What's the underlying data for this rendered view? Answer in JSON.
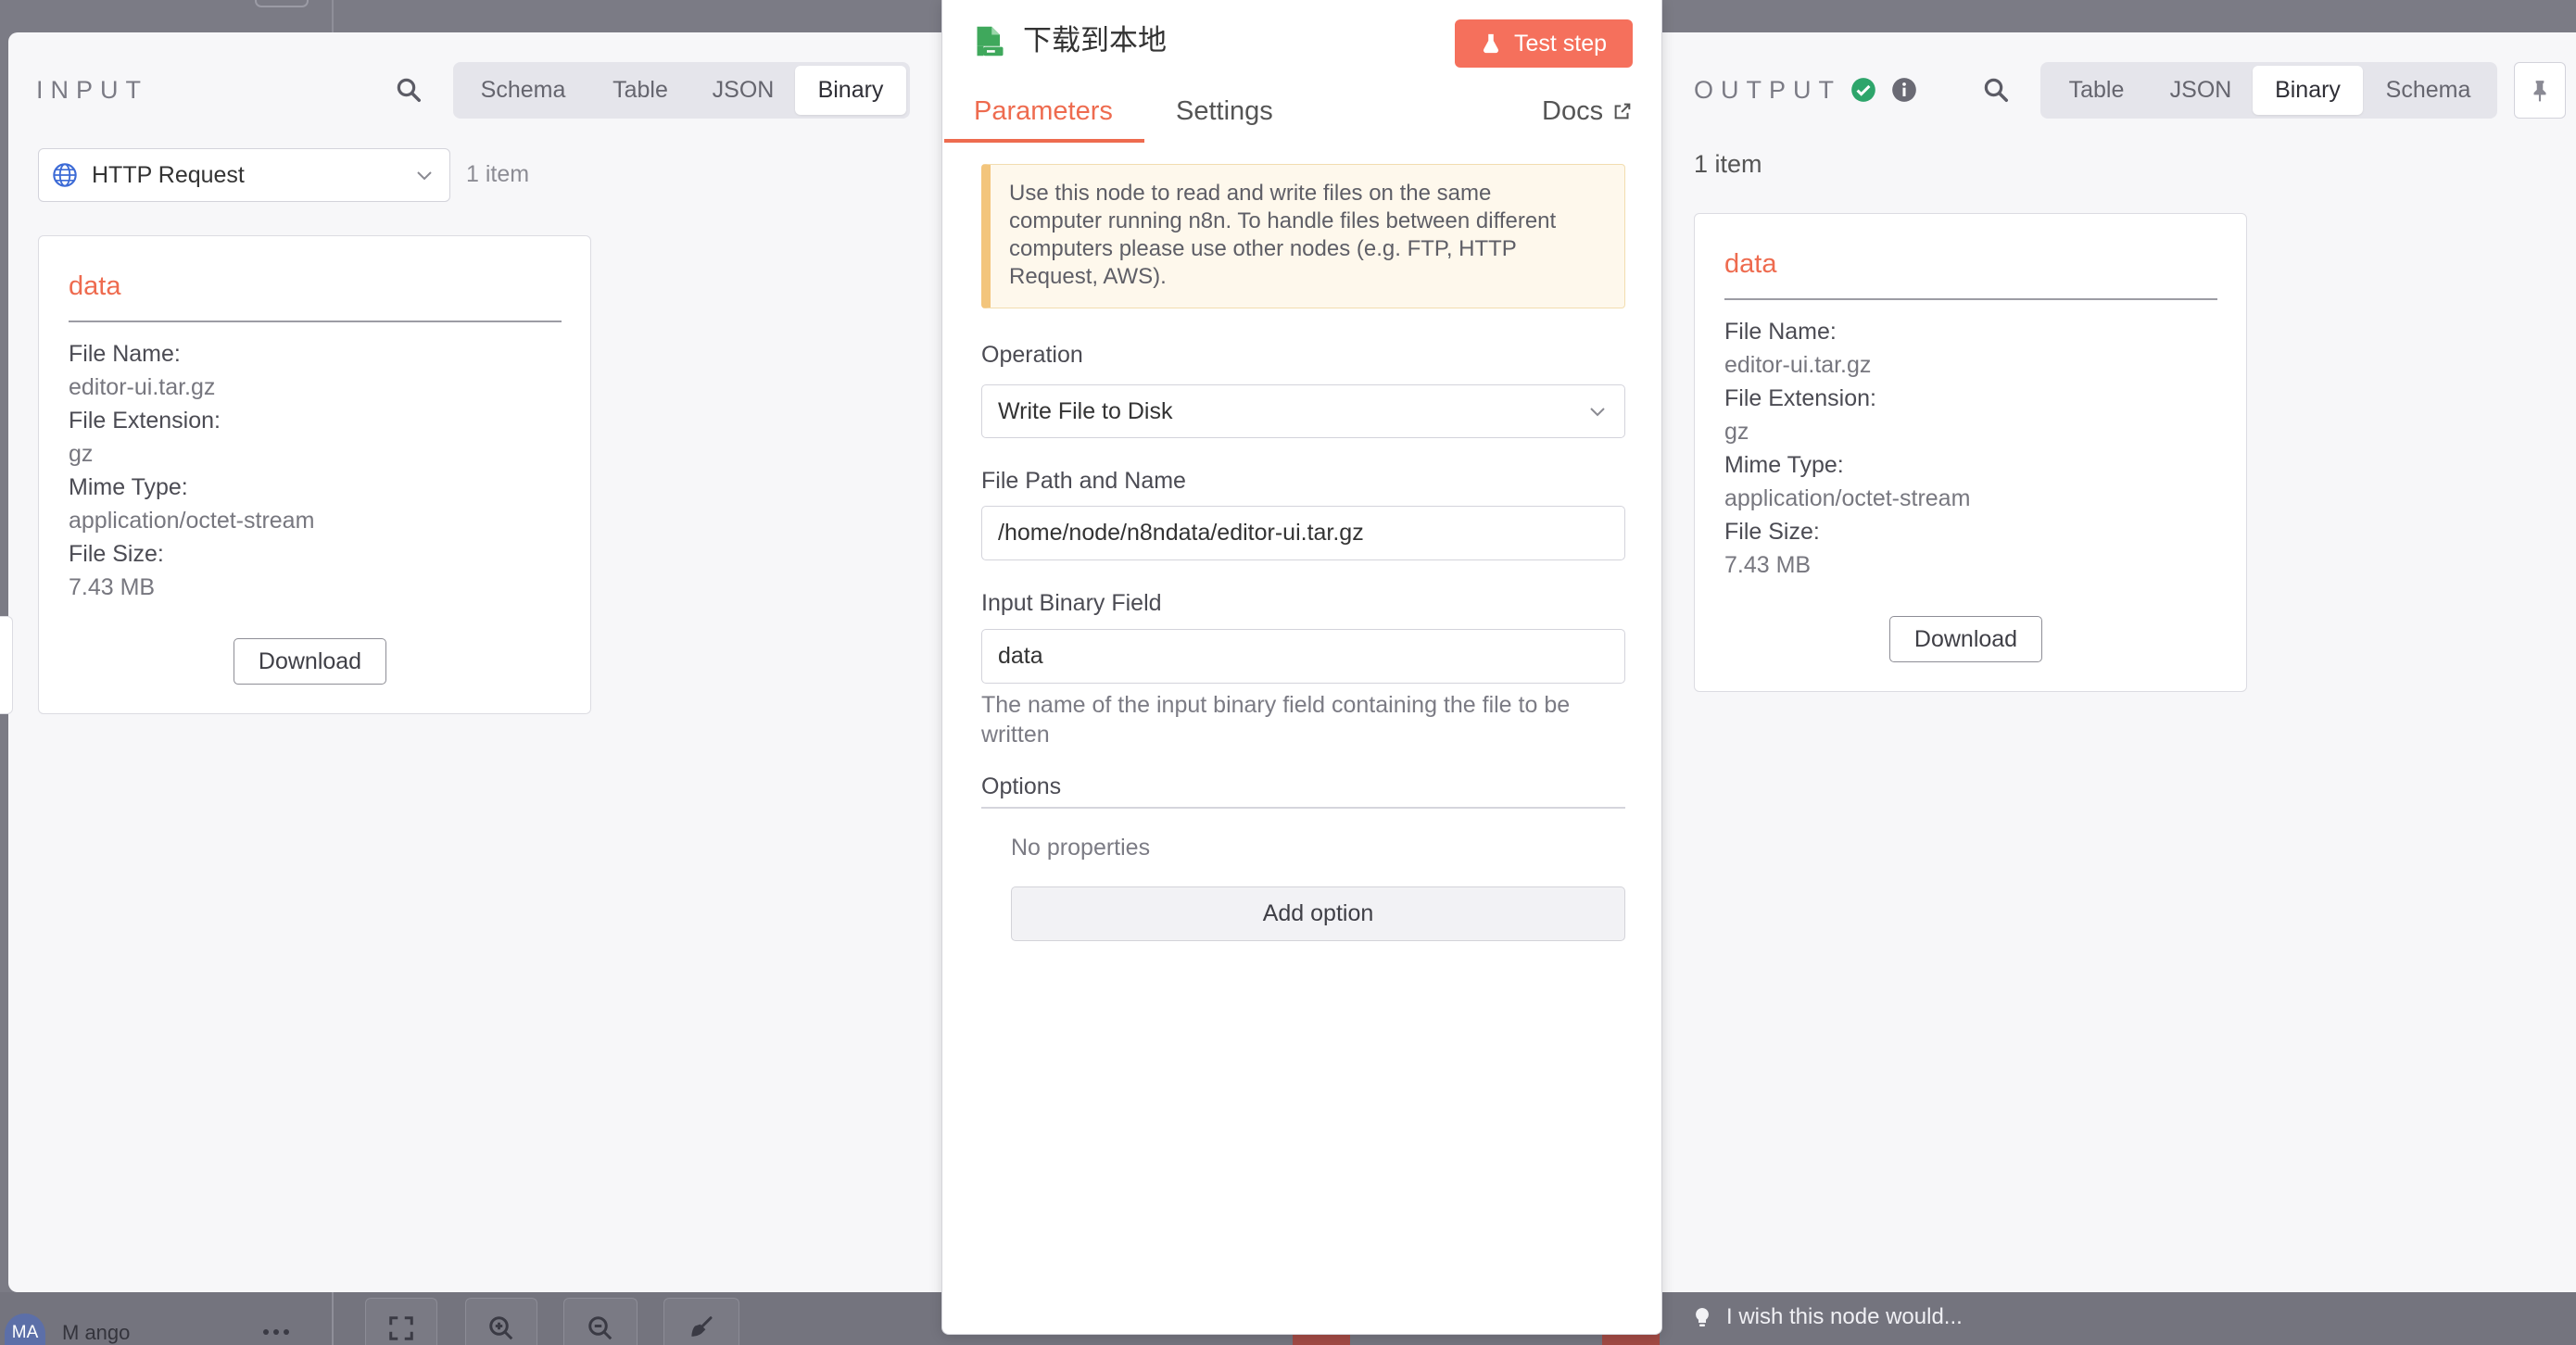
{
  "input": {
    "title": "INPUT",
    "view_tabs": [
      {
        "label": "Schema",
        "active": false
      },
      {
        "label": "Table",
        "active": false
      },
      {
        "label": "JSON",
        "active": false
      },
      {
        "label": "Binary",
        "active": true
      }
    ],
    "source_node": "HTTP Request",
    "item_count": "1 item",
    "binary_card": {
      "title": "data",
      "fields": [
        {
          "label": "File Name:",
          "value": "editor-ui.tar.gz"
        },
        {
          "label": "File Extension:",
          "value": "gz"
        },
        {
          "label": "Mime Type:",
          "value": "application/octet-stream"
        },
        {
          "label": "File Size:",
          "value": "7.43 MB"
        }
      ],
      "download_label": "Download"
    }
  },
  "node": {
    "title": "下载到本地",
    "test_step_label": "Test step",
    "tabs": [
      {
        "label": "Parameters",
        "active": true
      },
      {
        "label": "Settings",
        "active": false
      }
    ],
    "docs_label": "Docs",
    "notice_lines": [
      "Use this node to read and write files on the same",
      "computer running n8n. To handle files between different",
      "computers please use other nodes (e.g. FTP, HTTP",
      "Request, AWS)."
    ],
    "operation": {
      "label": "Operation",
      "value": "Write File to Disk"
    },
    "file_path": {
      "label": "File Path and Name",
      "value": "/home/node/n8ndata/editor-ui.tar.gz"
    },
    "input_binary_field": {
      "label": "Input Binary Field",
      "value": "data",
      "hint_lines": [
        "The name of the input binary field containing the file to be",
        "written"
      ]
    },
    "options": {
      "label": "Options",
      "empty_text": "No properties",
      "add_label": "Add option"
    }
  },
  "output": {
    "title": "OUTPUT",
    "view_tabs": [
      {
        "label": "Table",
        "active": false
      },
      {
        "label": "JSON",
        "active": false
      },
      {
        "label": "Binary",
        "active": true
      },
      {
        "label": "Schema",
        "active": false
      }
    ],
    "item_count": "1 item",
    "binary_card": {
      "title": "data",
      "fields": [
        {
          "label": "File Name:",
          "value": "editor-ui.tar.gz"
        },
        {
          "label": "File Extension:",
          "value": "gz"
        },
        {
          "label": "Mime Type:",
          "value": "application/octet-stream"
        },
        {
          "label": "File Size:",
          "value": "7.43 MB"
        }
      ],
      "download_label": "Download"
    }
  },
  "canvas_footer": {
    "avatar_initials": "MA",
    "user_name": "M ango",
    "feedback_text": "I wish this node would..."
  },
  "colors": {
    "accent": "#ee6b4f",
    "test_button": "#f5705c",
    "success": "#2ea56b",
    "node_icon": "#3fa85c",
    "notice_bg": "#fef8ec",
    "notice_stripe": "#f3c57c",
    "overlay": "#7b7b85"
  },
  "icons": {
    "search": "search-icon",
    "source_node": "globe-icon",
    "dropdown": "chevron-down-icon",
    "node": "file-disk-icon",
    "test_step": "flask-icon",
    "docs": "external-link-icon",
    "output_status": "check-circle-icon",
    "output_info": "info-icon",
    "pin": "pin-icon",
    "feedback": "lightbulb-icon",
    "more": "more-icon",
    "fit_view": "fit-view-icon",
    "zoom_in": "zoom-in-icon",
    "zoom_out": "zoom-out-icon",
    "tidy": "broom-icon"
  }
}
